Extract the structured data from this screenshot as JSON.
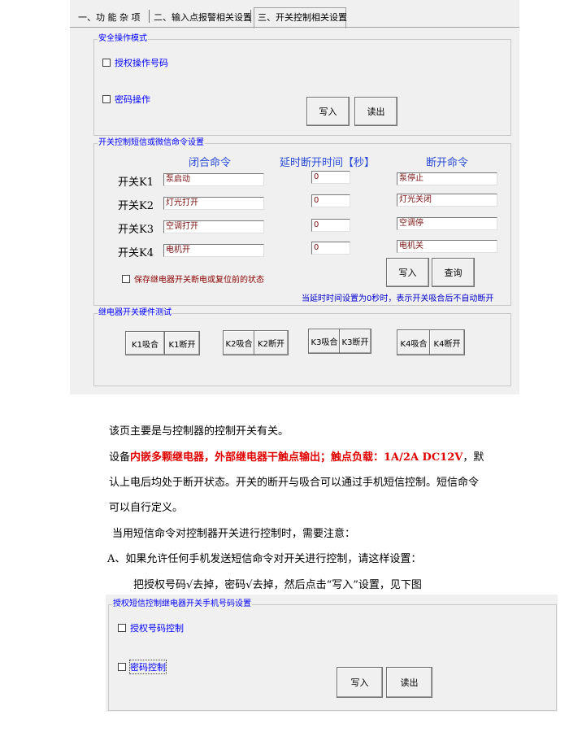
{
  "tabs": [
    "一、功 能 杂 项",
    "二、输入点报警相关设置",
    "三、开关控制相关设置"
  ],
  "safety": {
    "title": "安全操作模式",
    "auth_label": "授权操作号码",
    "pwd_label": "密码操作",
    "write": "写入",
    "read": "读出"
  },
  "sms": {
    "title": "开关控制短信或微信命令设置",
    "col_close": "闭合命令",
    "col_delay": "延时断开时间【秒】",
    "col_open": "断开命令",
    "rows": [
      {
        "label": "开关K1",
        "close": "泵启动",
        "delay": "0",
        "open": "泵停止"
      },
      {
        "label": "开关K2",
        "close": "灯光打开",
        "delay": "0",
        "open": "灯光关闭"
      },
      {
        "label": "开关K3",
        "close": "空调打开",
        "delay": "0",
        "open": "空调停"
      },
      {
        "label": "开关K4",
        "close": "电机开",
        "delay": "0",
        "open": "电机关"
      }
    ],
    "save_state_label": "保存继电器开关断电或复位前的状态",
    "write": "写入",
    "query": "查询",
    "note": "当延时时间设置为0秒时，表示开关吸合后不自动断开"
  },
  "relay": {
    "title": "继电器开关硬件测试",
    "buttons": [
      {
        "on": "K1吸合",
        "off": "K1断开"
      },
      {
        "on": "K2吸合",
        "off": "K2断开"
      },
      {
        "on": "K3吸合",
        "off": "K3断开"
      },
      {
        "on": "K4吸合",
        "off": "K4断开"
      }
    ]
  },
  "doc": {
    "p1": "该页主要是与控制器的控制开关有关。",
    "p2_pre": "设备",
    "p2_red": "内嵌多颗继电器，外部继电器干触点输出；触点负载：1A/2A DC12V",
    "p2_post": "，默",
    "p3": "认上电后均处于断开状态。开关的断开与吸合可以通过手机短信控制。短信命令",
    "p4": "可以自行定义。",
    "p5": "当用短信命令对控制器开关进行控制时，需要注意：",
    "p6": "A、如果允许任何手机发送短信命令对开关进行控制，请这样设置：",
    "p7": "把授权号码√去掉，密码√去掉，然后点击“写入”设置，见下图"
  },
  "auth2": {
    "title": "授权短信控制继电器开关手机号码设置",
    "auth_label": "授权号码控制",
    "pwd_label": "密码控制",
    "write": "写入",
    "read": "读出"
  }
}
